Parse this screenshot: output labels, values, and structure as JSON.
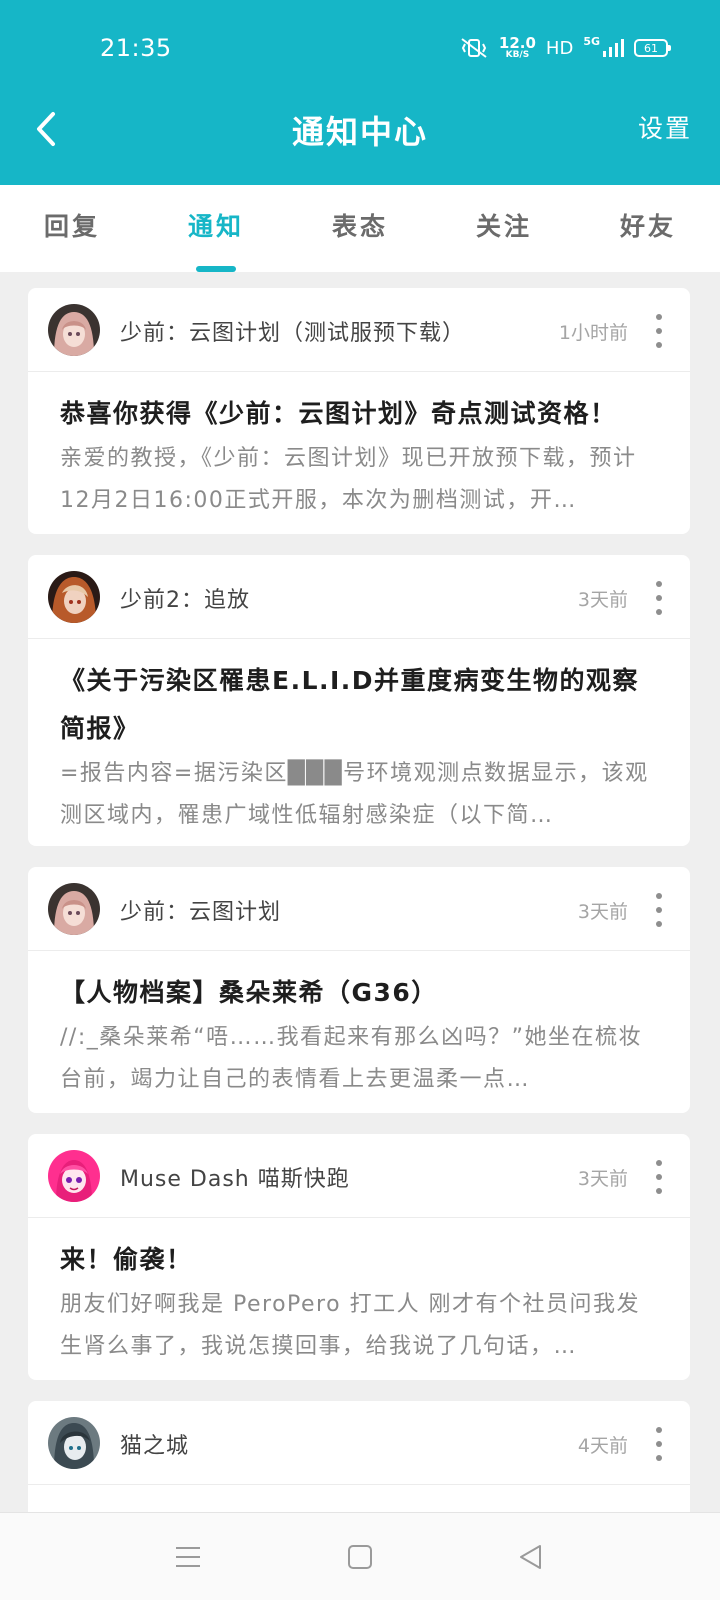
{
  "status_bar": {
    "time": "21:35",
    "net_speed_value": "12.0",
    "net_speed_unit": "KB/S",
    "hd": "HD",
    "network": "5G",
    "battery": "61"
  },
  "header": {
    "title": "通知中心",
    "settings_label": "设置"
  },
  "tabs": [
    {
      "label": "回复",
      "active": false
    },
    {
      "label": "通知",
      "active": true
    },
    {
      "label": "表态",
      "active": false
    },
    {
      "label": "关注",
      "active": false
    },
    {
      "label": "好友",
      "active": false
    }
  ],
  "accent_color": "#16b6c7",
  "notifications": [
    {
      "source": "少前：云图计划（测试服预下载）",
      "time": "1小时前",
      "title": "恭喜你获得《少前：云图计划》奇点测试资格！",
      "excerpt": "亲爱的教授，《少前：云图计划》现已开放预下载，预计12月2日16:00正式开服，本次为删档测试，开…"
    },
    {
      "source": "少前2：追放",
      "time": "3天前",
      "title": "《关于污染区罹患E.L.I.D并重度病变生物的观察简报》",
      "excerpt": "=报告内容=据污染区███号环境观测点数据显示，该观测区域内，罹患广域性低辐射感染症（以下简…"
    },
    {
      "source": "少前：云图计划",
      "time": "3天前",
      "title": "【人物档案】桑朵莱希（G36）",
      "excerpt": "//:_桑朵莱希“唔……我看起来有那么凶吗？”她坐在梳妆台前，竭力让自己的表情看上去更温柔一点…"
    },
    {
      "source": "Muse Dash 喵斯快跑",
      "time": "3天前",
      "title": "来！偷袭！",
      "excerpt": "朋友们好啊我是 PeroPero 打工人 刚才有个社员问我发生肾么事了，我说怎摸回事，给我说了几句话，…"
    },
    {
      "source": "猫之城",
      "time": "4天前",
      "title": "",
      "excerpt": ""
    }
  ]
}
